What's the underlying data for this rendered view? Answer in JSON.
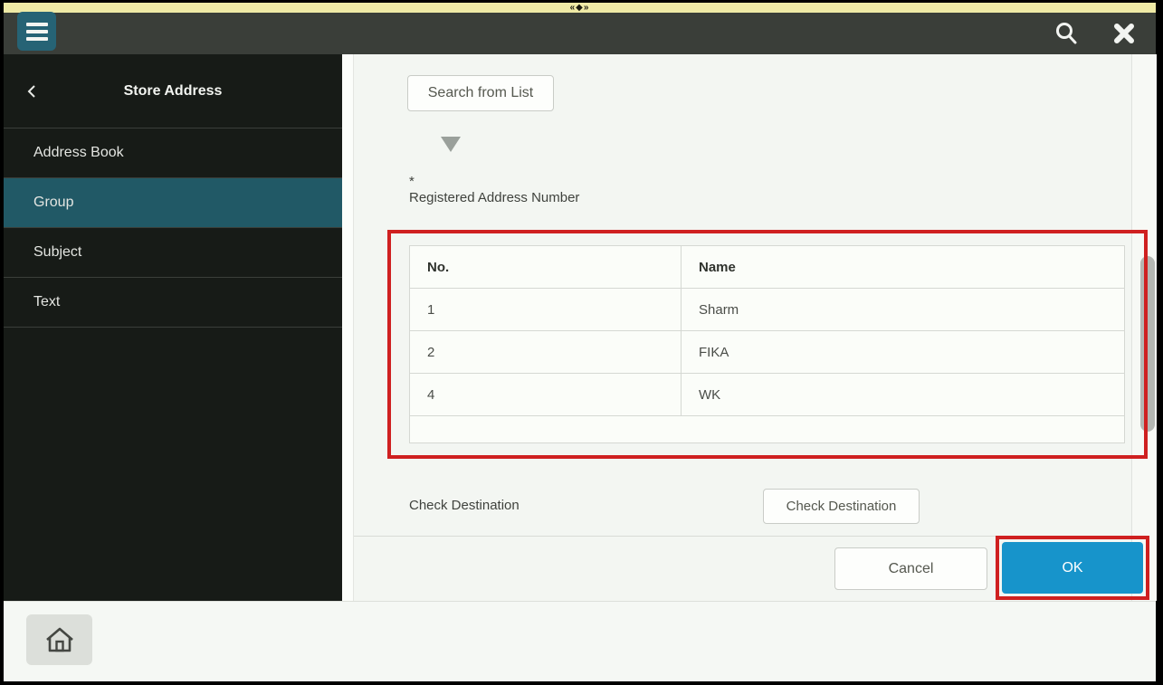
{
  "bezel": {
    "top_marker": "«◆»"
  },
  "header": {
    "menu_icon": "hamburger-icon",
    "search_icon": "magnifier-icon",
    "close_icon": "x-icon"
  },
  "sidebar": {
    "title": "Store Address",
    "items": [
      {
        "label": "Address Book",
        "selected": false
      },
      {
        "label": "Group",
        "selected": true
      },
      {
        "label": "Subject",
        "selected": false
      },
      {
        "label": "Text",
        "selected": false
      }
    ]
  },
  "main": {
    "search_from_list_label": "Search from List",
    "required_marker": "*",
    "registered_address_label": "Registered Address Number",
    "table": {
      "headers": {
        "no": "No.",
        "name": "Name"
      },
      "rows": [
        {
          "no": "1",
          "name": "Sharm"
        },
        {
          "no": "2",
          "name": "FIKA"
        },
        {
          "no": "4",
          "name": "WK"
        }
      ]
    },
    "check_destination_label": "Check Destination",
    "check_destination_button": "Check Destination"
  },
  "footer": {
    "cancel_label": "Cancel",
    "ok_label": "OK"
  },
  "colors": {
    "accent_teal": "#266375",
    "selected_teal": "#215966",
    "header_bar": "#3a3e39",
    "sidebar_bg": "#171b17",
    "bezel_yellow": "#efeaa6",
    "ok_blue": "#1794cb",
    "annotation_red": "#cf2020"
  }
}
